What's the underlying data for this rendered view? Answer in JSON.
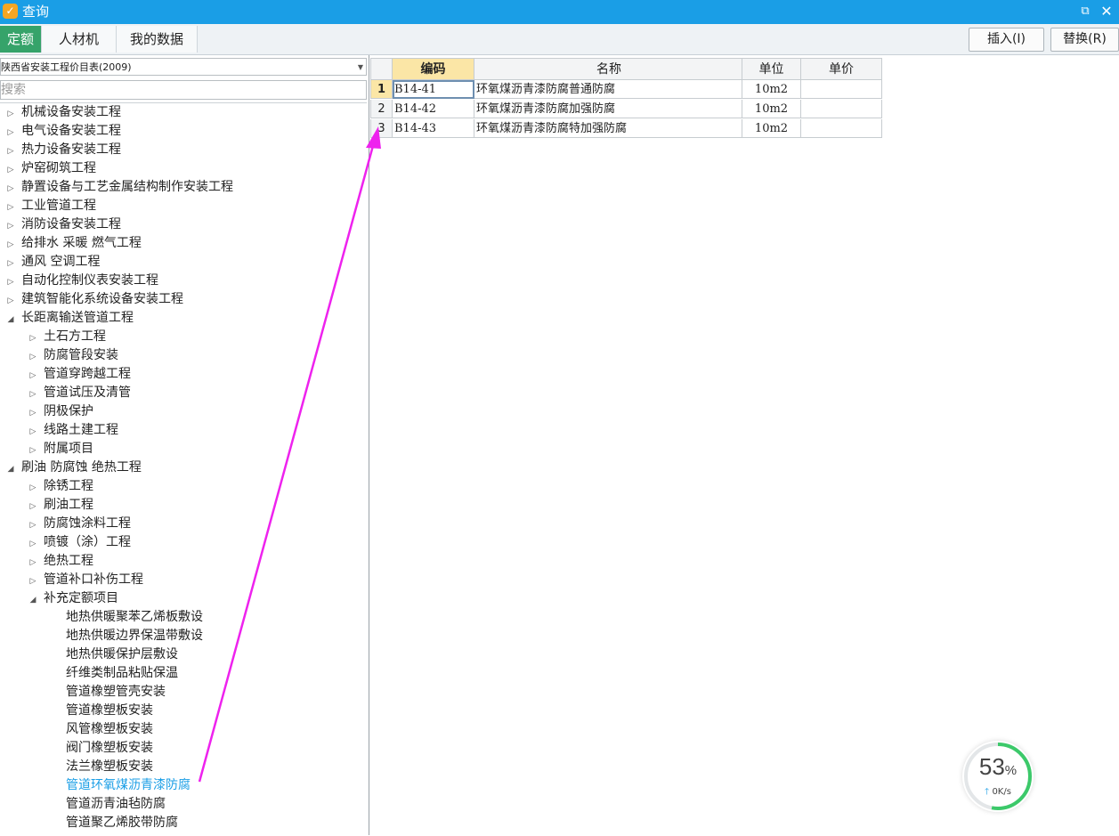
{
  "window": {
    "title": "查询",
    "app_icon": "app-logo-icon",
    "controls": {
      "restore_icon": "⧉",
      "close_icon": "✕"
    }
  },
  "tabs": [
    {
      "label": "定额",
      "active": true
    },
    {
      "label": "人材机",
      "active": false
    },
    {
      "label": "我的数据",
      "active": false
    }
  ],
  "actions": {
    "insert_label": "插入(I)",
    "replace_label": "替换(R)"
  },
  "library": {
    "selected": "陕西省安装工程价目表(2009)"
  },
  "search": {
    "placeholder": "搜索",
    "value": ""
  },
  "tree": [
    {
      "label": "机械设备安装工程",
      "level": 0,
      "expanded": false,
      "leaf": false
    },
    {
      "label": "电气设备安装工程",
      "level": 0,
      "expanded": false,
      "leaf": false
    },
    {
      "label": "热力设备安装工程",
      "level": 0,
      "expanded": false,
      "leaf": false
    },
    {
      "label": "炉窑砌筑工程",
      "level": 0,
      "expanded": false,
      "leaf": false
    },
    {
      "label": "静置设备与工艺金属结构制作安装工程",
      "level": 0,
      "expanded": false,
      "leaf": false
    },
    {
      "label": "工业管道工程",
      "level": 0,
      "expanded": false,
      "leaf": false
    },
    {
      "label": "消防设备安装工程",
      "level": 0,
      "expanded": false,
      "leaf": false
    },
    {
      "label": "给排水 采暖 燃气工程",
      "level": 0,
      "expanded": false,
      "leaf": false
    },
    {
      "label": "通风 空调工程",
      "level": 0,
      "expanded": false,
      "leaf": false
    },
    {
      "label": "自动化控制仪表安装工程",
      "level": 0,
      "expanded": false,
      "leaf": false
    },
    {
      "label": "建筑智能化系统设备安装工程",
      "level": 0,
      "expanded": false,
      "leaf": false
    },
    {
      "label": "长距离输送管道工程",
      "level": 0,
      "expanded": true,
      "leaf": false
    },
    {
      "label": "土石方工程",
      "level": 1,
      "expanded": false,
      "leaf": false
    },
    {
      "label": "防腐管段安装",
      "level": 1,
      "expanded": false,
      "leaf": false
    },
    {
      "label": "管道穿跨越工程",
      "level": 1,
      "expanded": false,
      "leaf": false
    },
    {
      "label": "管道试压及清管",
      "level": 1,
      "expanded": false,
      "leaf": false
    },
    {
      "label": "阴极保护",
      "level": 1,
      "expanded": false,
      "leaf": false
    },
    {
      "label": "线路土建工程",
      "level": 1,
      "expanded": false,
      "leaf": false
    },
    {
      "label": "附属项目",
      "level": 1,
      "expanded": false,
      "leaf": false
    },
    {
      "label": "刷油 防腐蚀 绝热工程",
      "level": 0,
      "expanded": true,
      "leaf": false
    },
    {
      "label": "除锈工程",
      "level": 1,
      "expanded": false,
      "leaf": false
    },
    {
      "label": "刷油工程",
      "level": 1,
      "expanded": false,
      "leaf": false
    },
    {
      "label": "防腐蚀涂料工程",
      "level": 1,
      "expanded": false,
      "leaf": false
    },
    {
      "label": "喷镀（涂）工程",
      "level": 1,
      "expanded": false,
      "leaf": false
    },
    {
      "label": "绝热工程",
      "level": 1,
      "expanded": false,
      "leaf": false
    },
    {
      "label": "管道补口补伤工程",
      "level": 1,
      "expanded": false,
      "leaf": false
    },
    {
      "label": "补充定额项目",
      "level": 1,
      "expanded": true,
      "leaf": false
    },
    {
      "label": "地热供暖聚苯乙烯板敷设",
      "level": 2,
      "leaf": true
    },
    {
      "label": "地热供暖边界保温带敷设",
      "level": 2,
      "leaf": true
    },
    {
      "label": "地热供暖保护层敷设",
      "level": 2,
      "leaf": true
    },
    {
      "label": "纤维类制品粘贴保温",
      "level": 2,
      "leaf": true
    },
    {
      "label": "管道橡塑管壳安装",
      "level": 2,
      "leaf": true
    },
    {
      "label": "管道橡塑板安装",
      "level": 2,
      "leaf": true
    },
    {
      "label": "风管橡塑板安装",
      "level": 2,
      "leaf": true
    },
    {
      "label": "阀门橡塑板安装",
      "level": 2,
      "leaf": true
    },
    {
      "label": "法兰橡塑板安装",
      "level": 2,
      "leaf": true
    },
    {
      "label": "管道环氧煤沥青漆防腐",
      "level": 2,
      "leaf": true,
      "selected": true
    },
    {
      "label": "管道沥青油毡防腐",
      "level": 2,
      "leaf": true
    },
    {
      "label": "管道聚乙烯胶带防腐",
      "level": 2,
      "leaf": true
    }
  ],
  "grid": {
    "headers": {
      "code": "编码",
      "name": "名称",
      "unit": "单位",
      "price": "单价"
    },
    "rows": [
      {
        "num": "1",
        "code": "B14-41",
        "name": "环氧煤沥青漆防腐普通防腐",
        "unit": "10m2",
        "price": ""
      },
      {
        "num": "2",
        "code": "B14-42",
        "name": "环氧煤沥青漆防腐加强防腐",
        "unit": "10m2",
        "price": ""
      },
      {
        "num": "3",
        "code": "B14-43",
        "name": "环氧煤沥青漆防腐特加强防腐",
        "unit": "10m2",
        "price": ""
      }
    ]
  },
  "speed_widget": {
    "percent": "53",
    "percent_sign": "%",
    "rate": "0K/s",
    "progress": 0.53
  },
  "colors": {
    "titlebar": "#1a9ee6",
    "active_tab": "#36a36a",
    "annotation_arrow": "#ee22ee",
    "selected_item": "#1a9ee6",
    "progress_ring": "#3cc96a"
  }
}
